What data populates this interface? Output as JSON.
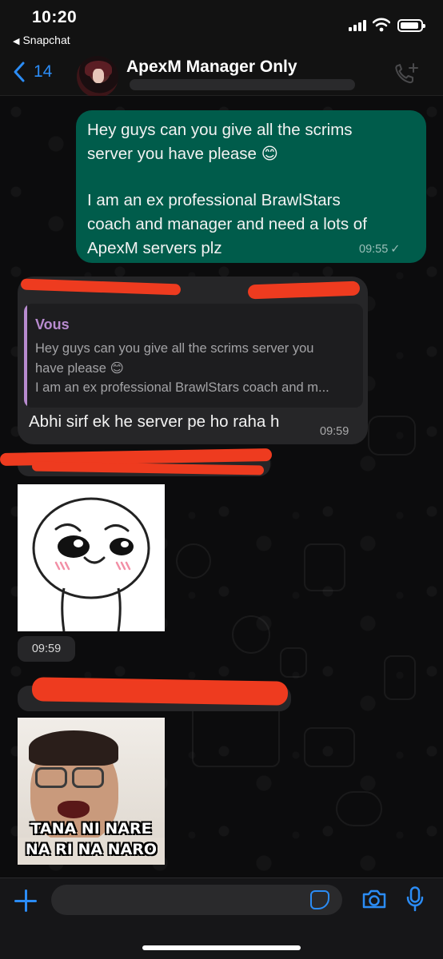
{
  "status_bar": {
    "time": "10:20",
    "back_app": "Snapchat"
  },
  "header": {
    "back_count": "14",
    "group_name": "ApexM Manager Only"
  },
  "messages": {
    "outgoing": {
      "line1": "Hey guys can you give all the scrims",
      "line2": "server you have please 😊",
      "line3": "I am an ex professional BrawlStars",
      "line4": "coach and manager and need a lots of",
      "line5": "ApexM servers plz",
      "time": "09:55",
      "status": "✓"
    },
    "reply": {
      "quoted_author": "Vous",
      "quoted_line1": "Hey guys can you give all the scrims server you",
      "quoted_line2": "have please 😊",
      "quoted_line3": "I am an ex professional BrawlStars coach and m...",
      "text": "Abhi sirf ek he server pe ho raha h",
      "time": "09:59"
    },
    "sticker": {
      "time": "09:59"
    },
    "photo": {
      "caption_line1": "TANA NI NARE",
      "caption_line2": "NA RI NA NARO"
    }
  },
  "colors": {
    "accent": "#2b8cf5",
    "outgoing_bubble": "#005c4b",
    "incoming_bubble": "#262628",
    "quote_author": "#b88bcf",
    "redaction": "#ee3b1f"
  }
}
